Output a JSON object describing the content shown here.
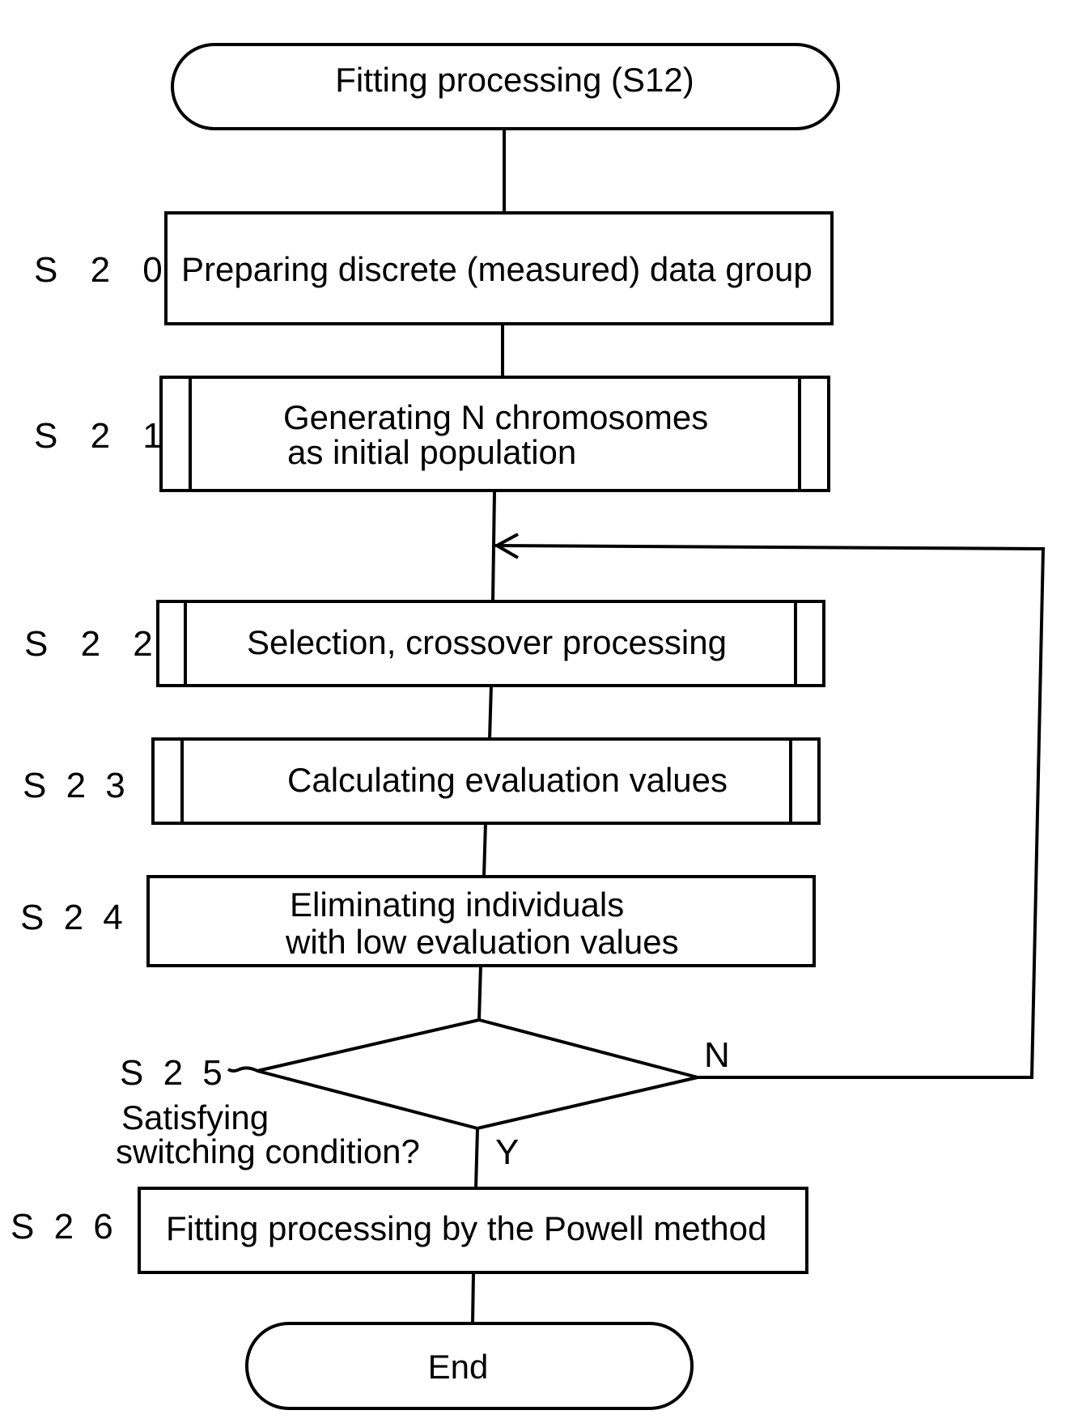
{
  "diagram": {
    "type": "flowchart",
    "start": {
      "label": "Fitting processing (S12)"
    },
    "steps": [
      {
        "id": "S20",
        "step_label": "S 2 0",
        "lines": [
          "Preparing discrete (measured) data group"
        ],
        "kind": "process"
      },
      {
        "id": "S21",
        "step_label": "S 2 1",
        "lines": [
          "Generating N chromosomes",
          "as initial population"
        ],
        "kind": "predefined-process"
      },
      {
        "id": "S22",
        "step_label": "S 2 2",
        "lines": [
          "Selection, crossover processing"
        ],
        "kind": "predefined-process"
      },
      {
        "id": "S23",
        "step_label": "S 2 3",
        "lines": [
          "Calculating evaluation values"
        ],
        "kind": "predefined-process"
      },
      {
        "id": "S24",
        "step_label": "S 2 4",
        "lines": [
          "Eliminating individuals",
          "with low evaluation values"
        ],
        "kind": "process"
      }
    ],
    "decision": {
      "id": "S25",
      "step_label": "S 2 5",
      "lines": [
        "Satisfying",
        "switching condition?"
      ],
      "yes_label": "Y",
      "no_label": "N",
      "no_target": "S22"
    },
    "final_step": {
      "id": "S26",
      "step_label": "S 2 6",
      "lines": [
        "Fitting processing by the Powell method"
      ],
      "kind": "process"
    },
    "end": {
      "label": "End"
    }
  }
}
